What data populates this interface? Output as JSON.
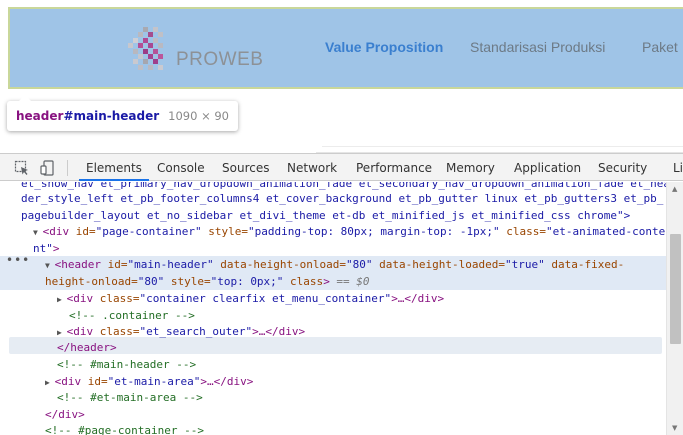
{
  "page": {
    "logo_text": "PROWEB",
    "nav": {
      "value_proposition": "Value Proposition",
      "standarisasi_produksi": "Standarisasi Produksi",
      "paket": "Paket"
    },
    "tooltip": {
      "tag": "header",
      "id": "#main-header",
      "dims": "1090 × 90"
    }
  },
  "devtools": {
    "tabs": [
      "Elements",
      "Console",
      "Sources",
      "Network",
      "Performance",
      "Memory",
      "Application",
      "Security",
      "Li"
    ],
    "active_tab": "Elements",
    "icons": {
      "inspect": "inspect-element-icon",
      "device": "device-toolbar-icon"
    },
    "lines": {
      "l0_classes": "et_show_nav et_primary_nav_dropdown_animation_fade et_secondary_nav_dropdown_animation_fade et_hea",
      "l1_classes": "der_style_left et_pb_footer_columns4 et_cover_background et_pb_gutter linux et_pb_gutters3 et_pb_",
      "l2_classes": "pagebuilder_layout et_no_sidebar et_divi_theme et-db et_minified_js et_minified_css chrome\">",
      "page_container": {
        "open": "<div ",
        "id_attr": "id=",
        "id_val": "\"page-container\"",
        "style_attr": " style=",
        "style_val": "\"padding-top: 80px; margin-top: -1px;\"",
        "class_attr": " class=",
        "class_val": "\"et-animated-conte"
      },
      "page_container_wrap": "nt\"",
      "header_open": {
        "open": "<header ",
        "id_attr": "id=",
        "id_val": "\"main-header\"",
        "hlo_attr": " data-height-onload=",
        "hlo_val": "\"80\"",
        "hl_attr": " data-height-loaded=",
        "hl_val": "\"true\"",
        "fixed_attr": " data-fixed-"
      },
      "header_open_wrap": {
        "attr": "height-onload=",
        "val": "\"80\"",
        "style_attr": " style=",
        "style_val": "\"top: 0px;\"",
        "class_attr": " class",
        "close": ">",
        "sel": " == $0"
      },
      "menu_container": {
        "open": "<div ",
        "class_attr": "class=",
        "class_val": "\"container clearfix et_menu_container\"",
        "end": ">…</div>"
      },
      "container_comment": "<!-- .container -->",
      "search_outer": {
        "open": "<div ",
        "class_attr": "class=",
        "class_val": "\"et_search_outer\"",
        "end": ">…</div>"
      },
      "header_close": "</header>",
      "main_header_comment": "<!-- #main-header -->",
      "main_area": {
        "open": "<div ",
        "id_attr": "id=",
        "id_val": "\"et-main-area\"",
        "end": ">…</div>"
      },
      "main_area_comment": "<!-- #et-main-area -->",
      "div_close": "</div>",
      "page_container_comment": "<!-- #page-container -->"
    }
  },
  "colors": {
    "highlight": "#9fc4e7",
    "accent": "#3a7fcf",
    "tag": "#881280",
    "attr": "#994500",
    "value": "#1a1aa6",
    "comment": "#236e25"
  }
}
